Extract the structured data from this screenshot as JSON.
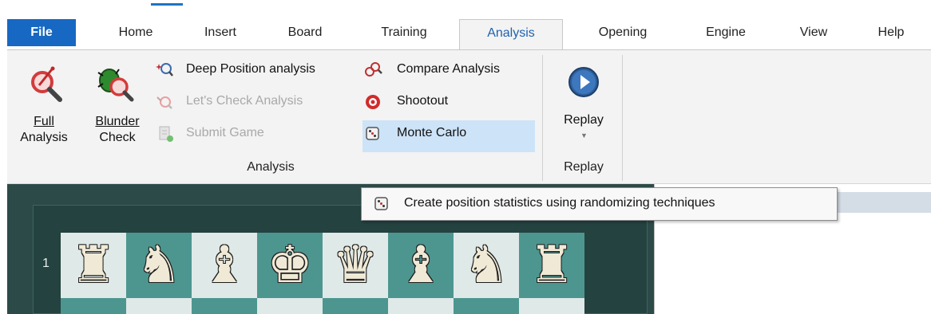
{
  "tabs": [
    {
      "label": "File"
    },
    {
      "label": "Home"
    },
    {
      "label": "Insert"
    },
    {
      "label": "Board"
    },
    {
      "label": "Training"
    },
    {
      "label": "Analysis"
    },
    {
      "label": "Opening"
    },
    {
      "label": "Engine"
    },
    {
      "label": "View"
    },
    {
      "label": "Help"
    }
  ],
  "ribbon": {
    "full_analysis": {
      "line1": "Full",
      "line2": "Analysis"
    },
    "blunder_check": {
      "line1": "Blunder",
      "line2": "Check"
    },
    "deep_position": "Deep Position analysis",
    "lets_check": "Let's Check Analysis",
    "submit_game": "Submit Game",
    "compare_analysis": "Compare Analysis",
    "shootout": "Shootout",
    "monte_carlo": "Monte Carlo",
    "analysis_group": "Analysis",
    "replay_button": "Replay",
    "replay_group": "Replay"
  },
  "tooltip": {
    "text": "Create position statistics using randomizing techniques"
  },
  "board": {
    "rank_label": "1",
    "pieces": [
      "♜",
      "♞",
      "♝",
      "♚",
      "♛",
      "♝",
      "♞",
      "♜"
    ]
  },
  "colors": {
    "accent": "#1668c2",
    "highlight": "#cde3f7",
    "board_dark": "#4d9690",
    "board_light": "#dfe9e8"
  }
}
